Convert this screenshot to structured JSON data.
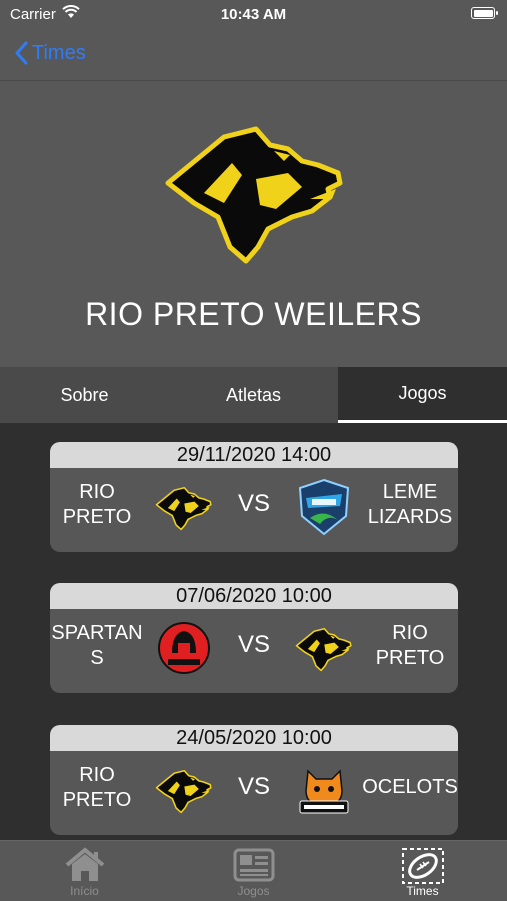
{
  "status_bar": {
    "carrier": "Carrier",
    "time": "10:43 AM"
  },
  "nav": {
    "back_label": "Times"
  },
  "team": {
    "name": "RIO PRETO WEILERS",
    "logo_icon": "dog-head-logo"
  },
  "tabs": [
    {
      "label": "Sobre",
      "active": false
    },
    {
      "label": "Atletas",
      "active": false
    },
    {
      "label": "Jogos",
      "active": true
    }
  ],
  "games": [
    {
      "date": "29/11/2020 14:00",
      "home": "RIO\nPRETO",
      "home_logo": "weilers-logo",
      "vs": "VS",
      "away": "LEME\nLIZARDS",
      "away_logo": "lizards-logo"
    },
    {
      "date": "07/06/2020 10:00",
      "home": "SPARTAN\nS",
      "home_logo": "spartans-logo",
      "vs": "VS",
      "away": "RIO\nPRETO",
      "away_logo": "weilers-logo"
    },
    {
      "date": "24/05/2020 10:00",
      "home": "RIO\nPRETO",
      "home_logo": "weilers-logo",
      "vs": "VS",
      "away": "OCELOTS",
      "away_logo": "ocelots-logo"
    }
  ],
  "tab_bar": [
    {
      "label": "Início",
      "icon": "home-icon",
      "active": false
    },
    {
      "label": "Jogos",
      "icon": "news-icon",
      "active": false
    },
    {
      "label": "Times",
      "icon": "football-icon",
      "active": true
    }
  ],
  "colors": {
    "accent": "#2f7df6",
    "header_bg": "#585858",
    "content_bg": "#2f2f2f",
    "card_bg": "#575757",
    "date_bg": "#d9d9d9",
    "logo_yellow": "#f1d21a"
  }
}
